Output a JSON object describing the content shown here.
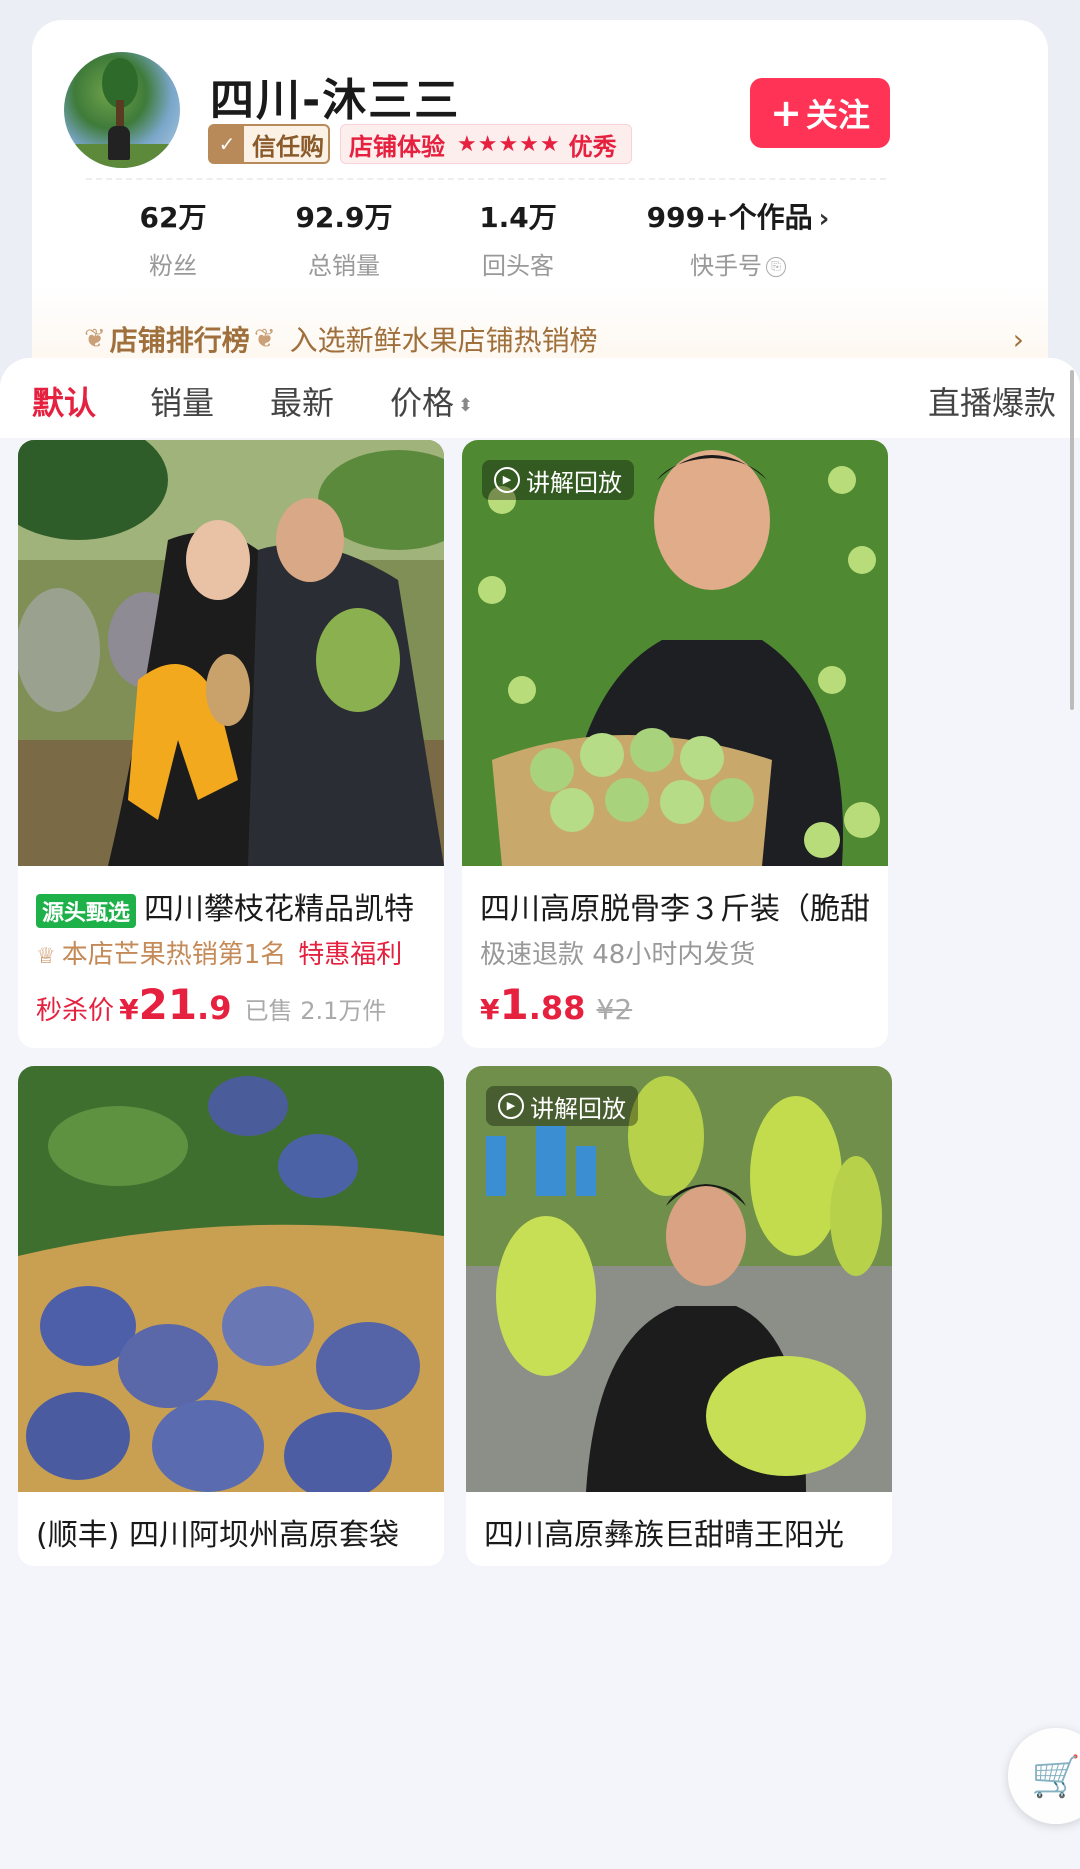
{
  "shop": {
    "name": "四川-沐三三",
    "trust_badge": "信任购",
    "experience_label": "店铺体验",
    "experience_stars": "★★★★★",
    "experience_grade": "优秀",
    "follow_label": "关注",
    "stats": [
      {
        "value": "62万",
        "label": "粉丝"
      },
      {
        "value": "92.9万",
        "label": "总销量"
      },
      {
        "value": "1.4万",
        "label": "回头客"
      },
      {
        "value": "999+个作品",
        "label": "快手号"
      }
    ],
    "ranking": {
      "title": "店铺排行榜",
      "desc": "入选新鲜水果店铺热销榜"
    }
  },
  "tabs": [
    "默认",
    "销量",
    "最新",
    "价格",
    "直播爆款"
  ],
  "products": [
    {
      "tag": "源头甄选",
      "title": "四川攀枝花精品凯特",
      "rank": "本店芒果热销第1名",
      "promo": "特惠福利",
      "price_label": "秒杀价",
      "yen": "¥",
      "price_int": "21",
      "price_dec": ".9",
      "sold": "已售 2.1万件"
    },
    {
      "replay": "讲解回放",
      "title": "四川高原脱骨李３斤装（脆甜",
      "sub": "极速退款  48小时内发货",
      "yen": "¥",
      "price_int": "1",
      "price_dec": ".88",
      "old_price": "¥2"
    },
    {
      "title": "(顺丰) 四川阿坝州高原套袋"
    },
    {
      "replay": "讲解回放",
      "title": "四川高原彝族巨甜晴王阳光"
    }
  ],
  "colors": {
    "accent": "#fe3355",
    "price": "#e6213f",
    "gold": "#a0703c",
    "source_green": "#1eb14a"
  }
}
